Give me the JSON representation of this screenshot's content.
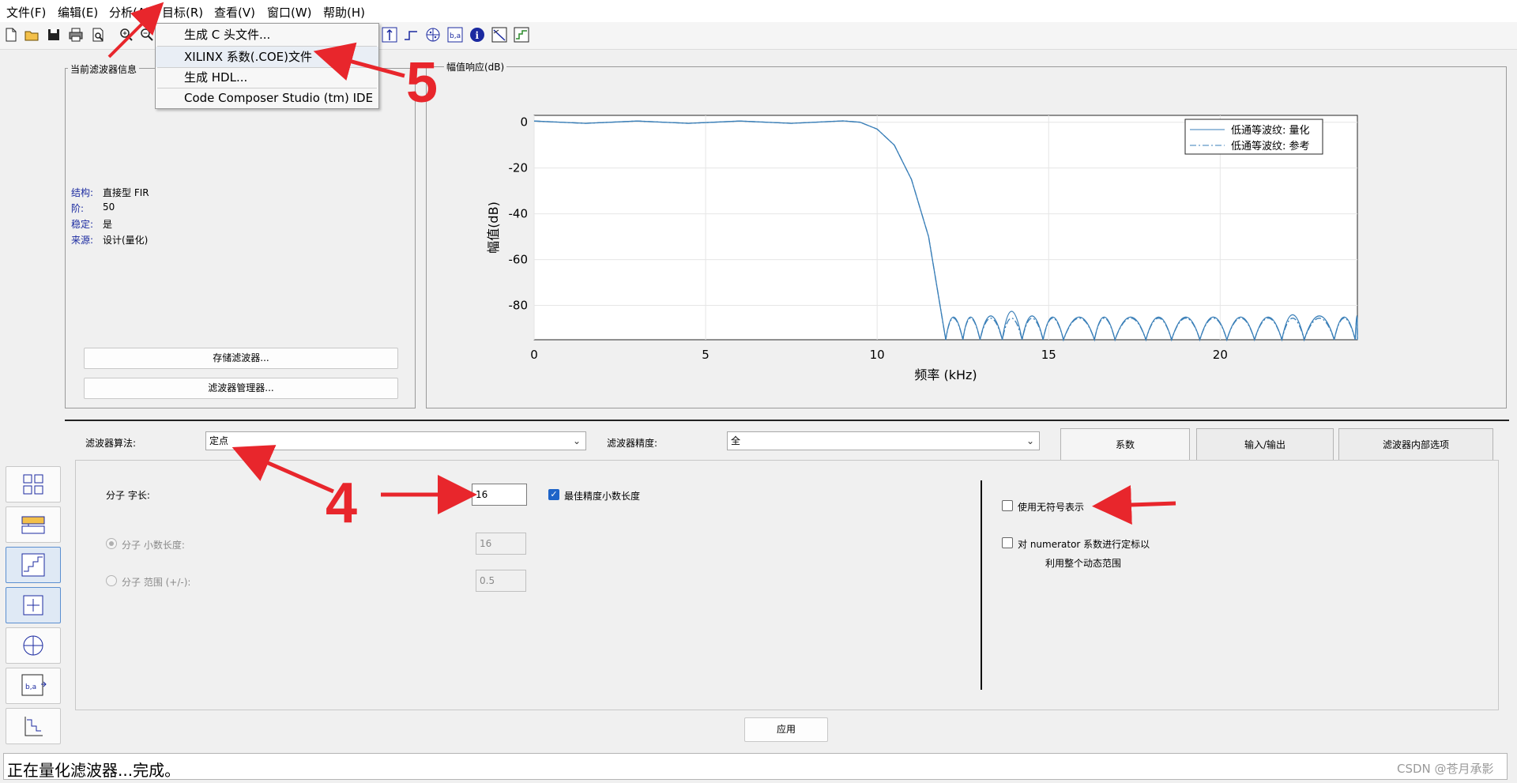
{
  "menubar": [
    "文件(F)",
    "编辑(E)",
    "分析(A)",
    "目标(R)",
    "查看(V)",
    "窗口(W)",
    "帮助(H)"
  ],
  "target_menu": [
    "生成 C 头文件...",
    "XILINX 系数(.COE)文件",
    "生成 HDL...",
    "Code Composer Studio (tm) IDE"
  ],
  "current_filter": {
    "title": "当前滤波器信息",
    "structure_key": "结构:",
    "structure_val": "直接型 FIR",
    "order_key": "阶:",
    "order_val": "50",
    "stable_key": "稳定:",
    "stable_val": "是",
    "source_key": "来源:",
    "source_val": "设计(量化)",
    "store_button": "存储滤波器...",
    "manager_button": "滤波器管理器..."
  },
  "magnitude_panel": {
    "title": "幅值响应(dB)"
  },
  "chart_data": {
    "type": "line",
    "title": "",
    "xlabel": "频率 (kHz)",
    "ylabel": "幅值(dB)",
    "xlim": [
      0,
      24
    ],
    "ylim": [
      -95,
      3
    ],
    "xticks": [
      0,
      5,
      10,
      15,
      20
    ],
    "yticks": [
      0,
      -20,
      -40,
      -60,
      -80
    ],
    "grid": true,
    "legend_position": "top-right",
    "series": [
      {
        "name": "低通等波纹: 量化",
        "style": "solid",
        "color": "#3a7fb8",
        "x": [
          0,
          1.5,
          3,
          4.5,
          6,
          7.5,
          9.0,
          9.5,
          10.0,
          10.5,
          11.0,
          11.5,
          12.0
        ],
        "y": [
          0.5,
          -0.5,
          0.5,
          -0.5,
          0.5,
          -0.5,
          0.6,
          0,
          -3,
          -10,
          -25,
          -50,
          -95
        ],
        "sidelobe_peaks": [
          [
            12.2,
            -80
          ],
          [
            12.7,
            -80
          ],
          [
            13.3,
            -79
          ],
          [
            13.9,
            -75
          ],
          [
            14.5,
            -79
          ],
          [
            15.1,
            -80
          ],
          [
            15.9,
            -80
          ],
          [
            16.6,
            -80
          ],
          [
            17.4,
            -80
          ],
          [
            18.2,
            -80
          ],
          [
            19.0,
            -80
          ],
          [
            19.8,
            -80
          ],
          [
            20.6,
            -80
          ],
          [
            21.4,
            -80
          ],
          [
            22.1,
            -78
          ],
          [
            22.9,
            -79
          ],
          [
            23.6,
            -80
          ],
          [
            24.0,
            -79
          ]
        ]
      },
      {
        "name": "低通等波纹: 参考",
        "style": "dashdot",
        "color": "#3a7fb8",
        "x": [
          0,
          1.5,
          3,
          4.5,
          6,
          7.5,
          9.0,
          9.5,
          10.0,
          10.5,
          11.0,
          11.5,
          12.0
        ],
        "y": [
          0.5,
          -0.5,
          0.5,
          -0.5,
          0.5,
          -0.5,
          0.6,
          0,
          -3,
          -10,
          -25,
          -50,
          -95
        ],
        "sidelobe_peaks": [
          [
            12.2,
            -81
          ],
          [
            12.7,
            -81
          ],
          [
            13.3,
            -81
          ],
          [
            13.9,
            -81
          ],
          [
            14.5,
            -81
          ],
          [
            15.1,
            -81
          ],
          [
            15.9,
            -81
          ],
          [
            16.6,
            -81
          ],
          [
            17.4,
            -81
          ],
          [
            18.2,
            -81
          ],
          [
            19.0,
            -81
          ],
          [
            19.8,
            -81
          ],
          [
            20.6,
            -81
          ],
          [
            21.4,
            -81
          ],
          [
            22.1,
            -81
          ],
          [
            22.9,
            -81
          ],
          [
            23.6,
            -81
          ],
          [
            24.0,
            -81
          ]
        ]
      }
    ]
  },
  "quant": {
    "arithmetic_label": "滤波器算法:",
    "arithmetic_value": "定点",
    "precision_label": "滤波器精度:",
    "precision_value": "全",
    "tabs": [
      "系数",
      "输入/输出",
      "滤波器内部选项"
    ],
    "word_length_label": "分子 字长:",
    "word_length_value": "16",
    "best_precision_label": "最佳精度小数长度",
    "frac_length_label": "分子 小数长度:",
    "frac_length_value": "16",
    "range_label": "分子 范围 (+/-):",
    "range_value": "0.5",
    "unsigned_label": "使用无符号表示",
    "scale_label_1": "对 numerator 系数进行定标以",
    "scale_label_2": "利用整个动态范围",
    "apply_button": "应用"
  },
  "annotations": {
    "num_4": "4",
    "num_5": "5"
  },
  "status": {
    "text": "正在量化滤波器...完成。"
  },
  "watermark": "CSDN @苍月承影",
  "icons": [
    "new-file-icon",
    "open-folder-icon",
    "save-icon",
    "print-icon",
    "print-preview-icon",
    "zoom-in-icon",
    "zoom-out-icon",
    "magnitude-icon",
    "step-icon",
    "pole-zero-icon",
    "coeff-icon",
    "info-icon",
    "magnitude-phase-icon",
    "impulse-icon"
  ],
  "colors": {
    "accent": "#1e64c8",
    "arrow": "#e8262c",
    "curve": "#3a7fb8"
  }
}
